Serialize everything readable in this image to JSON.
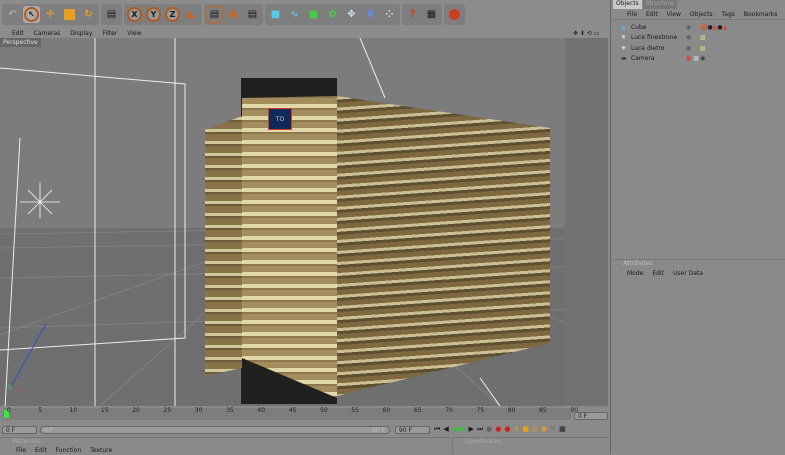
{
  "toolbar": {
    "icons": [
      "undo-icon",
      "live-selection-icon",
      "move-icon",
      "scale-icon",
      "rotate-icon",
      "recent-objects-icon",
      "x-axis-icon",
      "y-axis-icon",
      "z-axis-icon",
      "coordinate-system-icon",
      "render-view-icon",
      "render-picture-viewer-icon",
      "render-settings-icon",
      "cube-icon",
      "spline-icon",
      "nurbs-icon",
      "array-icon",
      "deformer-icon",
      "environment-icon",
      "camera-scene-icon",
      "help-icon",
      "layout-icon",
      "cinema-logo-icon"
    ],
    "x": "X",
    "y": "Y",
    "z": "Z"
  },
  "viewport": {
    "menu": [
      "Edit",
      "Cameras",
      "Display",
      "Filter",
      "View"
    ],
    "label": "Perspective",
    "marker": "TO"
  },
  "objects": {
    "tabs": [
      "Objects",
      "Structure"
    ],
    "menu": [
      "File",
      "Edit",
      "View",
      "Objects",
      "Tags",
      "Bookmarks"
    ],
    "items": [
      {
        "name": "Cube",
        "icon": "cube-icon"
      },
      {
        "name": "Luce finestrone",
        "icon": "light-icon"
      },
      {
        "name": "Luce dietro",
        "icon": "light-icon"
      },
      {
        "name": "Camera",
        "icon": "camera-icon"
      }
    ]
  },
  "attributes": {
    "title": "Attributes",
    "menu": [
      "Mode",
      "Edit",
      "User Data"
    ]
  },
  "timeline": {
    "ticks": [
      "0",
      "5",
      "10",
      "15",
      "20",
      "25",
      "30",
      "35",
      "40",
      "45",
      "50",
      "55",
      "60",
      "65",
      "70",
      "75",
      "80",
      "85",
      "90"
    ],
    "current_frame": "0 F",
    "start": "0 F",
    "range_start": "0 F",
    "range_end": "90 F",
    "end": "90 F",
    "position": 0
  },
  "materials": {
    "title": "Materials",
    "menu": [
      "File",
      "Edit",
      "Function",
      "Texture"
    ]
  },
  "coordinates": {
    "title": "Coordinates"
  },
  "colors": {
    "accent": "#c8641e",
    "active_tab": "#c8c8c8",
    "viewport_bg": "#7b7b7b"
  }
}
